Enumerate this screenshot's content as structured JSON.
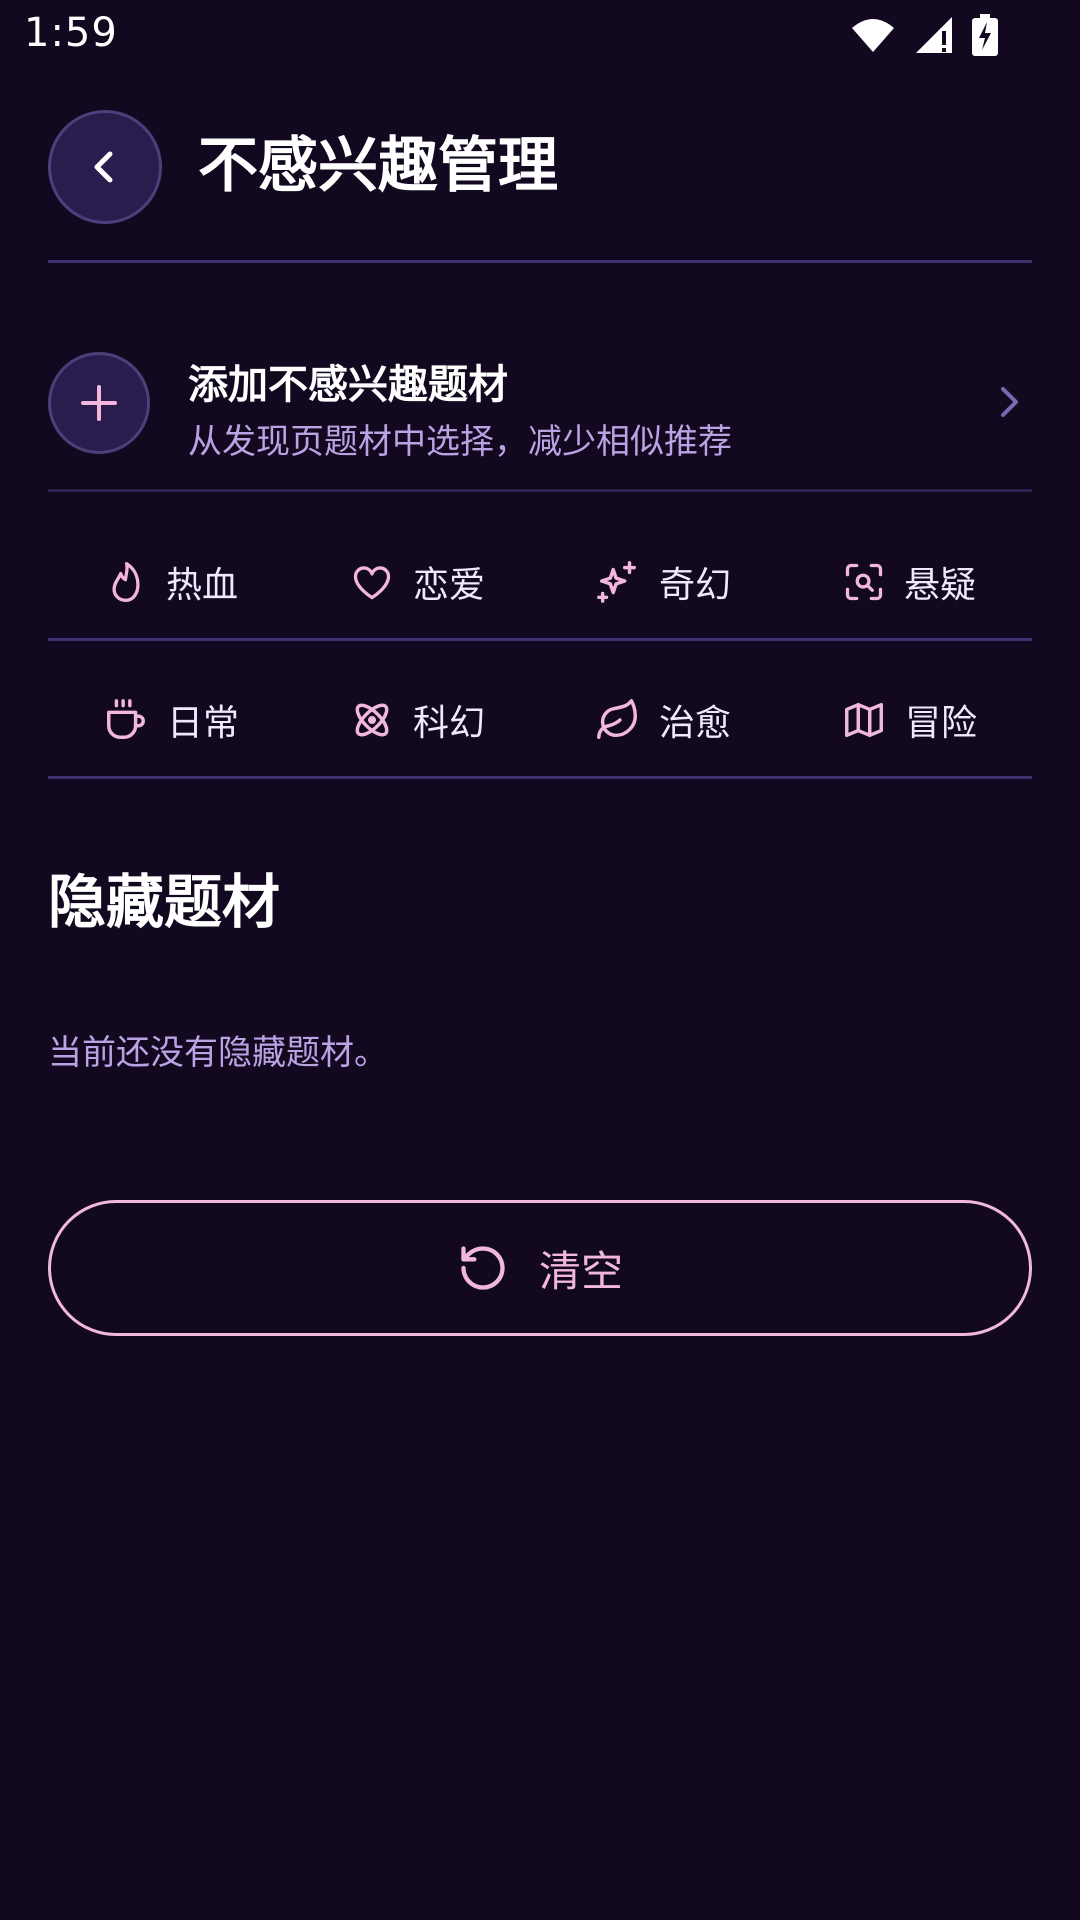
{
  "status_bar": {
    "time": "1:59"
  },
  "header": {
    "title": "不感兴趣管理"
  },
  "add_row": {
    "title": "添加不感兴趣题材",
    "subtitle": "从发现页题材中选择，减少相似推荐"
  },
  "genres": [
    {
      "label": "热血",
      "icon": "flame-icon"
    },
    {
      "label": "恋爱",
      "icon": "heart-icon"
    },
    {
      "label": "奇幻",
      "icon": "sparkles-icon"
    },
    {
      "label": "悬疑",
      "icon": "scan-search-icon"
    },
    {
      "label": "日常",
      "icon": "coffee-cup-icon"
    },
    {
      "label": "科幻",
      "icon": "atom-icon"
    },
    {
      "label": "治愈",
      "icon": "leaf-icon"
    },
    {
      "label": "冒险",
      "icon": "map-icon"
    }
  ],
  "hidden_section": {
    "title": "隐藏题材",
    "empty_text": "当前还没有隐藏题材。"
  },
  "clear_button": {
    "label": "清空",
    "icon": "reset-icon"
  },
  "colors": {
    "background": "#12081f",
    "accent_pink": "#f2b8dc",
    "muted_purple": "#b9a3e3",
    "divider": "#3e3170",
    "circle_fill": "#2a1d4d"
  }
}
